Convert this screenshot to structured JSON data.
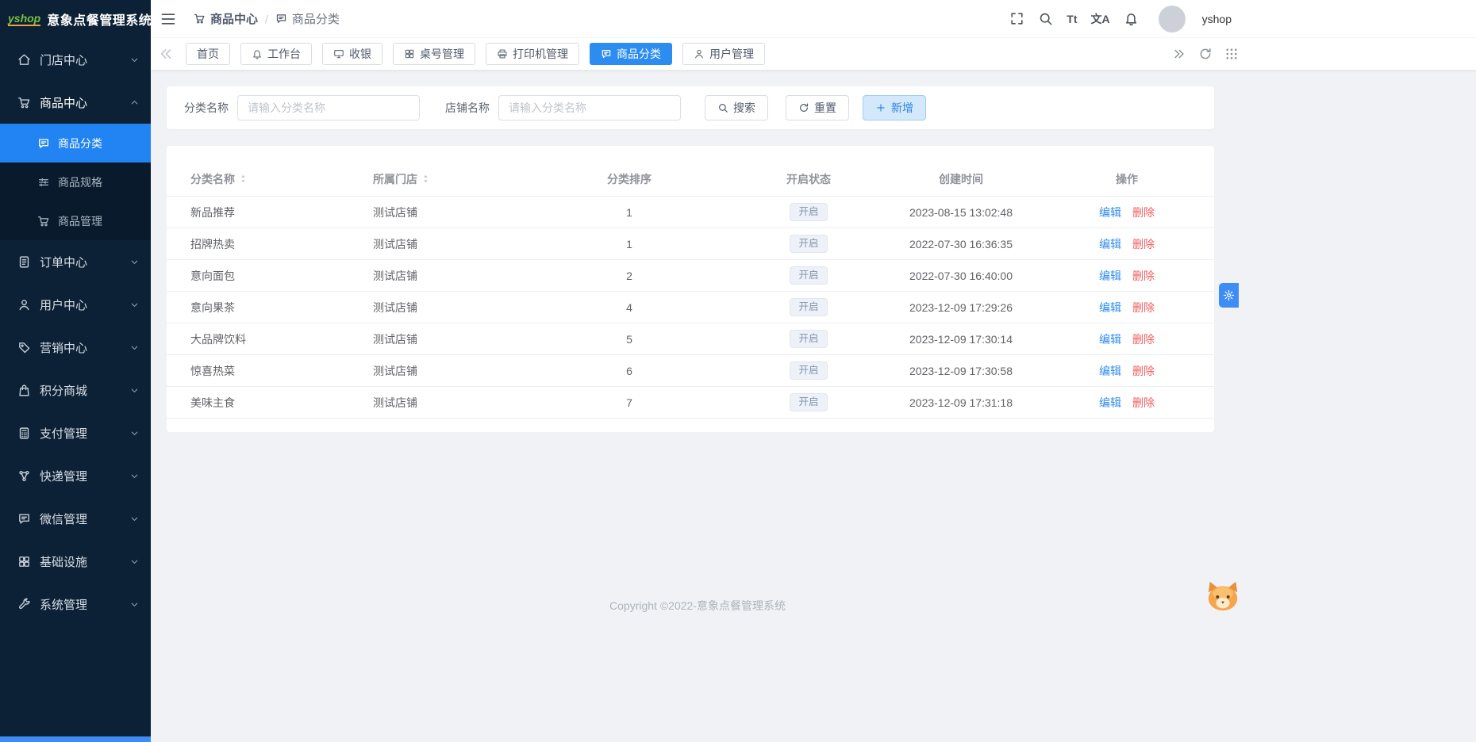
{
  "app": {
    "logo_text": "yshop",
    "title": "意象点餐管理系统"
  },
  "sidebar": {
    "items": [
      {
        "label": "门店中心",
        "icon": "home",
        "expanded": false
      },
      {
        "label": "商品中心",
        "icon": "cart",
        "expanded": true,
        "active": true,
        "children": [
          {
            "label": "商品分类",
            "icon": "chat",
            "active": true
          },
          {
            "label": "商品规格",
            "icon": "sliders",
            "active": false
          },
          {
            "label": "商品管理",
            "icon": "cart",
            "active": false
          }
        ]
      },
      {
        "label": "订单中心",
        "icon": "doc",
        "expanded": false
      },
      {
        "label": "用户中心",
        "icon": "user",
        "expanded": false
      },
      {
        "label": "营销中心",
        "icon": "tag",
        "expanded": false
      },
      {
        "label": "积分商城",
        "icon": "bag",
        "expanded": false
      },
      {
        "label": "支付管理",
        "icon": "calculator",
        "expanded": false
      },
      {
        "label": "快递管理",
        "icon": "share-nodes",
        "expanded": false
      },
      {
        "label": "微信管理",
        "icon": "chat",
        "expanded": false
      },
      {
        "label": "基础设施",
        "icon": "grid",
        "expanded": false
      },
      {
        "label": "系统管理",
        "icon": "wrench",
        "expanded": false
      }
    ]
  },
  "header": {
    "breadcrumb": [
      {
        "label": "商品中心",
        "icon": "cart"
      },
      {
        "label": "商品分类",
        "icon": "chat"
      }
    ],
    "separator": "/",
    "icons": [
      {
        "name": "fullscreen"
      },
      {
        "name": "search"
      },
      {
        "name": "font-size",
        "text": "Tt"
      },
      {
        "name": "translate",
        "text": "文A"
      },
      {
        "name": "bell"
      }
    ],
    "username": "yshop"
  },
  "tabbar": {
    "tabs": [
      {
        "label": "首页",
        "icon": null,
        "active": false
      },
      {
        "label": "工作台",
        "icon": "bell",
        "active": false
      },
      {
        "label": "收银",
        "icon": "monitor",
        "active": false
      },
      {
        "label": "桌号管理",
        "icon": "grid",
        "active": false
      },
      {
        "label": "打印机管理",
        "icon": "printer",
        "active": false
      },
      {
        "label": "商品分类",
        "icon": "chat",
        "active": true
      },
      {
        "label": "用户管理",
        "icon": "user",
        "active": false
      }
    ]
  },
  "filters": {
    "category_label": "分类名称",
    "category_placeholder": "请输入分类名称",
    "category_value": "",
    "store_label": "店铺名称",
    "store_placeholder": "请输入分类名称",
    "store_value": "",
    "search_label": "搜索",
    "reset_label": "重置",
    "add_label": "新增"
  },
  "table": {
    "columns": [
      {
        "label": "分类名称",
        "sortable": true,
        "align": "left"
      },
      {
        "label": "所属门店",
        "sortable": true,
        "align": "left"
      },
      {
        "label": "分类排序",
        "sortable": false,
        "align": "center"
      },
      {
        "label": "开启状态",
        "sortable": false,
        "align": "center"
      },
      {
        "label": "创建时间",
        "sortable": false,
        "align": "center"
      },
      {
        "label": "操作",
        "sortable": false,
        "align": "center"
      }
    ],
    "edit_label": "编辑",
    "delete_label": "删除",
    "rows": [
      {
        "name": "新品推荐",
        "store": "测试店铺",
        "sort": "1",
        "status": "开启",
        "created": "2023-08-15 13:02:48"
      },
      {
        "name": "招牌热卖",
        "store": "测试店铺",
        "sort": "1",
        "status": "开启",
        "created": "2022-07-30 16:36:35"
      },
      {
        "name": "意向面包",
        "store": "测试店铺",
        "sort": "2",
        "status": "开启",
        "created": "2022-07-30 16:40:00"
      },
      {
        "name": "意向果茶",
        "store": "测试店铺",
        "sort": "4",
        "status": "开启",
        "created": "2023-12-09 17:29:26"
      },
      {
        "name": "大品牌饮料",
        "store": "测试店铺",
        "sort": "5",
        "status": "开启",
        "created": "2023-12-09 17:30:14"
      },
      {
        "name": "惊喜热菜",
        "store": "测试店铺",
        "sort": "6",
        "status": "开启",
        "created": "2023-12-09 17:30:58"
      },
      {
        "name": "美味主食",
        "store": "测试店铺",
        "sort": "7",
        "status": "开启",
        "created": "2023-12-09 17:31:18"
      }
    ]
  },
  "footer": {
    "copyright": "Copyright ©2022-意象点餐管理系统"
  },
  "colors": {
    "accent": "#2d8cf0",
    "sidebar_bg": "#0c2135",
    "submenu_bg": "#081a2c",
    "active_blue": "#2184f2",
    "danger": "#f45b5b",
    "status_badge_text": "#7d94ad",
    "status_badge_bg": "#eef2f8"
  }
}
